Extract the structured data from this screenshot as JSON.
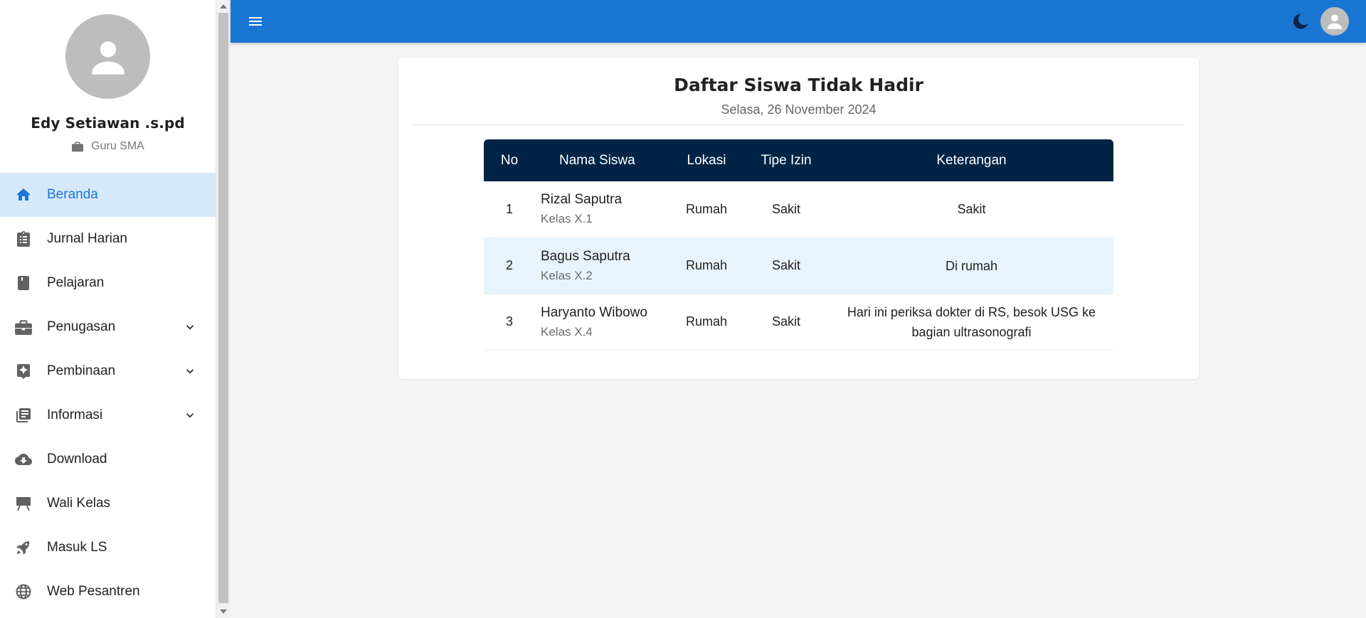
{
  "profile": {
    "name": "Edy Setiawan .s.pd",
    "role": "Guru SMA"
  },
  "sidebar": {
    "items": [
      {
        "label": "Beranda",
        "icon": "home-icon",
        "active": true,
        "expandable": false
      },
      {
        "label": "Jurnal Harian",
        "icon": "clipboard-icon",
        "active": false,
        "expandable": false
      },
      {
        "label": "Pelajaran",
        "icon": "book-icon",
        "active": false,
        "expandable": false
      },
      {
        "label": "Penugasan",
        "icon": "briefcase-icon",
        "active": false,
        "expandable": true
      },
      {
        "label": "Pembinaan",
        "icon": "star-badge-icon",
        "active": false,
        "expandable": true
      },
      {
        "label": "Informasi",
        "icon": "newspaper-icon",
        "active": false,
        "expandable": true
      },
      {
        "label": "Download",
        "icon": "cloud-download-icon",
        "active": false,
        "expandable": false
      },
      {
        "label": "Wali Kelas",
        "icon": "easel-icon",
        "active": false,
        "expandable": false
      },
      {
        "label": "Masuk LS",
        "icon": "rocket-icon",
        "active": false,
        "expandable": false
      },
      {
        "label": "Web Pesantren",
        "icon": "globe-icon",
        "active": false,
        "expandable": false
      }
    ]
  },
  "header": {
    "menu_icon": "hamburger-icon",
    "theme_icon": "moon-icon",
    "user_icon": "user-avatar-icon"
  },
  "main": {
    "title": "Daftar Siswa Tidak Hadir",
    "date": "Selasa, 26 November 2024",
    "table": {
      "columns": [
        "No",
        "Nama Siswa",
        "Lokasi",
        "Tipe Izin",
        "Keterangan"
      ],
      "rows": [
        {
          "no": "1",
          "name": "Rizal Saputra",
          "class": "Kelas X.1",
          "lokasi": "Rumah",
          "tipe": "Sakit",
          "keterangan": "Sakit"
        },
        {
          "no": "2",
          "name": "Bagus Saputra",
          "class": "Kelas X.2",
          "lokasi": "Rumah",
          "tipe": "Sakit",
          "keterangan": "Di rumah"
        },
        {
          "no": "3",
          "name": "Haryanto Wibowo",
          "class": "Kelas X.4",
          "lokasi": "Rumah",
          "tipe": "Sakit",
          "keterangan": "Hari ini periksa dokter di RS, besok USG ke bagian ultrasonografi"
        }
      ]
    }
  },
  "colors": {
    "primary": "#1976d2",
    "active_bg": "#d6e9fb",
    "table_header": "#012444",
    "row_alt": "#e8f4fd"
  }
}
